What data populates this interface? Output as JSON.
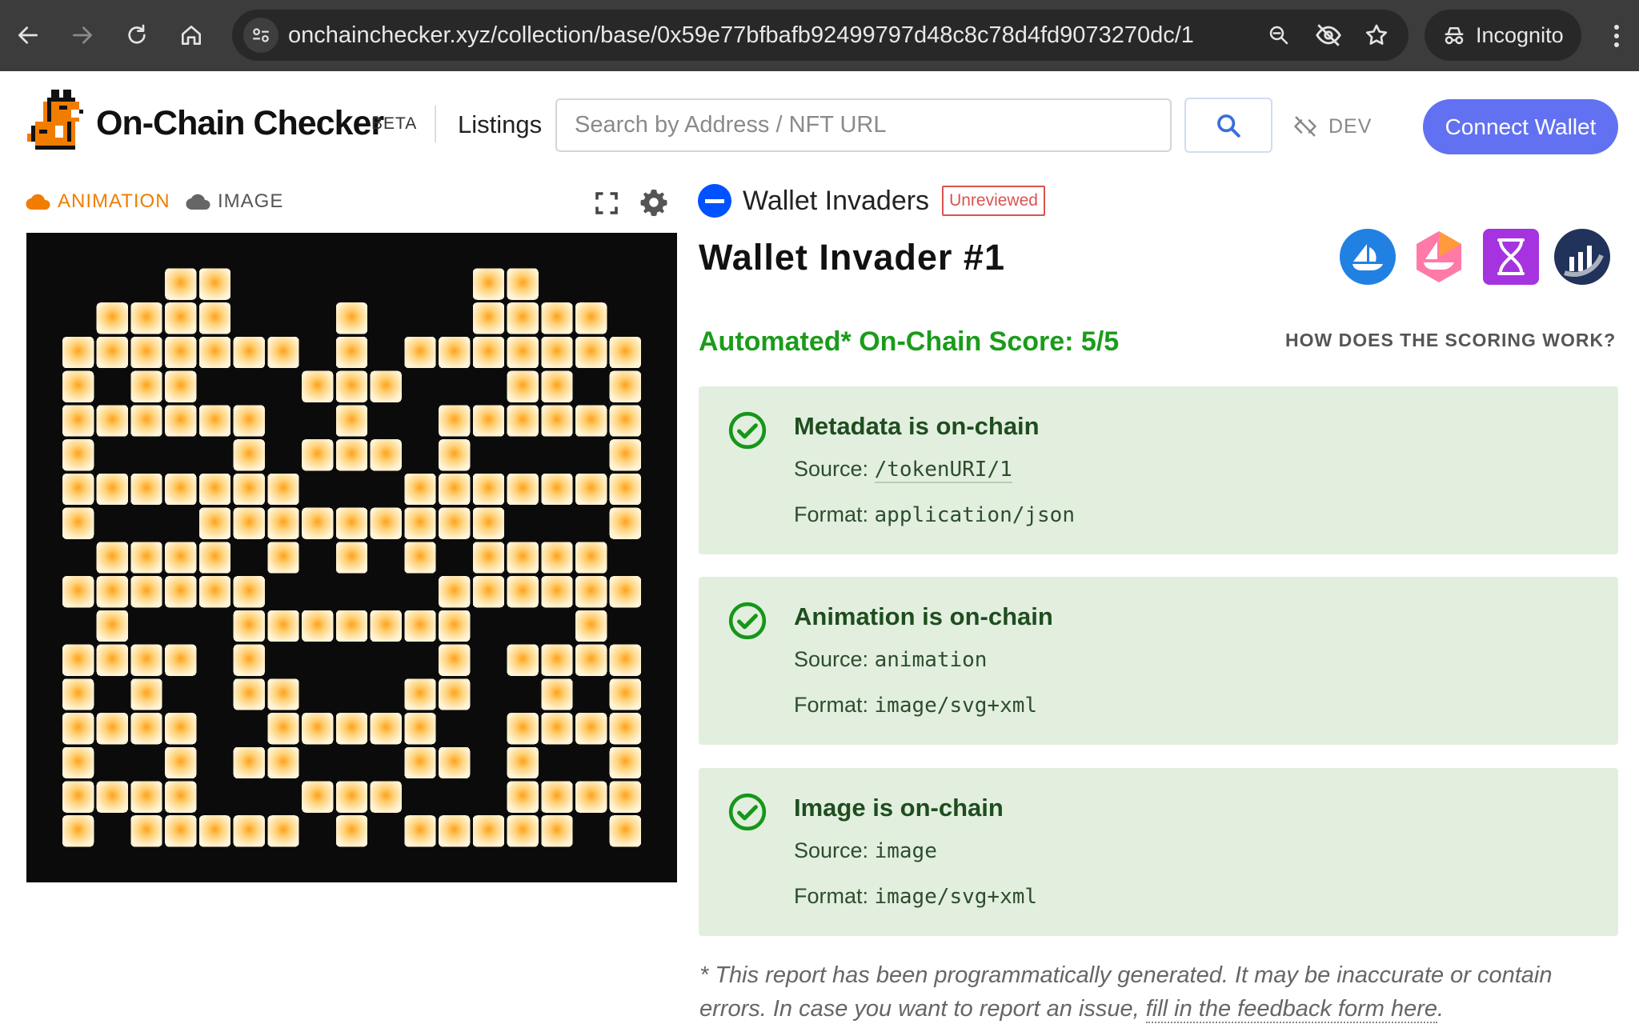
{
  "browser": {
    "url": "onchainchecker.xyz/collection/base/0x59e77bfbafb92499797d48c8c78d4fd9073270dc/1",
    "incognito_label": "Incognito"
  },
  "header": {
    "brand": "On-Chain Checker",
    "beta": "BETA",
    "listings": "Listings",
    "search_placeholder": "Search by Address / NFT URL",
    "dev_label": "DEV",
    "connect_label": "Connect Wallet"
  },
  "media": {
    "tabs": [
      {
        "label": "ANIMATION",
        "active": true
      },
      {
        "label": "IMAGE",
        "active": false
      }
    ]
  },
  "details": {
    "collection_name": "Wallet Invaders",
    "review_status": "Unreviewed",
    "token_title": "Wallet Invader #1",
    "marketplaces": [
      "opensea-icon",
      "looksrare-icon",
      "element-icon",
      "etherscan-icon"
    ],
    "score_text": "Automated* On-Chain Score: 5/5",
    "scoring_link": "HOW DOES THE SCORING WORK?",
    "checks": [
      {
        "title": "Metadata is on-chain",
        "source_label": "Source:",
        "source": "/tokenURI/1",
        "format_label": "Format:",
        "format": "application/json"
      },
      {
        "title": "Animation is on-chain",
        "source_label": "Source:",
        "source": "animation",
        "format_label": "Format:",
        "format": "image/svg+xml"
      },
      {
        "title": "Image is on-chain",
        "source_label": "Source:",
        "source": "image",
        "format_label": "Format:",
        "format": "image/svg+xml"
      }
    ],
    "disclaimer": "* This report has been programmatically generated. It may be inaccurate or contain errors. In case you want to report an issue,",
    "feedback_link": "fill in the feedback form here"
  },
  "colors": {
    "accent": "#6271f2",
    "score_green": "#1a9c1a",
    "card_bg": "#e2efdf",
    "animation_tab": "#f07d00",
    "badge_red": "#d9534f"
  }
}
